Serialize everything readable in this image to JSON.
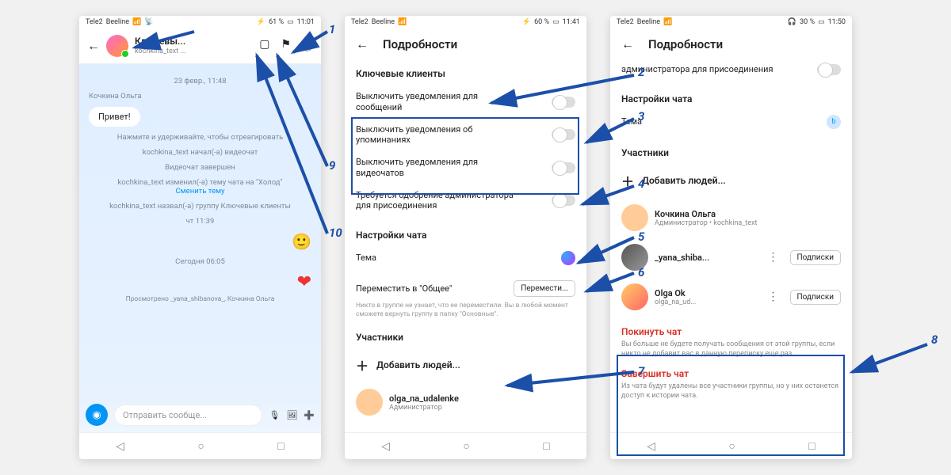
{
  "callouts": [
    "1",
    "2",
    "3",
    "4",
    "5",
    "6",
    "7",
    "8",
    "9",
    "10"
  ],
  "phone1": {
    "status": {
      "carrier1": "Tele2",
      "carrier2": "Beeline",
      "battery": "61 %",
      "time": "11:01"
    },
    "header": {
      "title": "Ключевы...",
      "subtitle": "kochkina_text ..."
    },
    "date1": "23 февр., 11:48",
    "sender": "Кочкина Ольга",
    "msg": "Привет!",
    "hint": "Нажмите и удерживайте, чтобы отреагировать",
    "sys1": "kochkina_text начал(-а) видеочат",
    "sys2": "Видеочат завершен",
    "sys3a": "kochkina_text изменил(-а) тему чата на \"Холод\"",
    "sys3b": "Сменить тему",
    "sys4": "kochkina_text назвал(-а) группу Ключевые клиенты",
    "time2": "чт 11:39",
    "time3": "Сегодня 06:05",
    "seen": "Просмотрено _yana_shibanova_, Кочкина Ольга",
    "composer": "Отправить сообще..."
  },
  "phone2": {
    "status": {
      "carrier1": "Tele2",
      "carrier2": "Beeline",
      "battery": "60 %",
      "time": "11:41"
    },
    "title": "Подробности",
    "group": "Ключевые клиенты",
    "toggles": {
      "t1": "Выключить уведомления для сообщений",
      "t2": "Выключить уведомления об упоминаниях",
      "t3": "Выключить уведомления для видеочатов",
      "t4": "Требуется одобрение администратора для присоединения"
    },
    "sect_settings": "Настройки чата",
    "theme_label": "Тема",
    "move_label": "Переместить в \"Общее\"",
    "move_btn": "Перемести...",
    "move_note": "Никто в группе не узнает, что ее переместили. Вы в любой момент сможете вернуть группу в папку \"Основные\".",
    "sect_members": "Участники",
    "add": "Добавить людей...",
    "member1_name": "olga_na_udalenke",
    "member1_role": "Администратор"
  },
  "phone3": {
    "status": {
      "carrier1": "Tele2",
      "carrier2": "Beeline",
      "battery": "30 %",
      "time": "11:50"
    },
    "title": "Подробности",
    "top_cut": "администратора для присоединения",
    "sect_settings": "Настройки чата",
    "theme_label": "Тема",
    "sect_members": "Участники",
    "add": "Добавить людей...",
    "m1_name": "Кочкина Ольга",
    "m1_role": "Администратор • kochkina_text",
    "m2_name": "_yana_shiba...",
    "m3_name": "Olga Ok",
    "m3_sub": "olga_na_ud...",
    "sub_btn": "Подписки",
    "leave": "Покинуть чат",
    "leave_note": "Вы больше не будете получать сообщения от этой группы, если никто не добавит вас в данную переписку еще раз.",
    "end": "Завершить чат",
    "end_note": "Из чата будут удалены все участники группы, но у них останется доступ к истории чата."
  }
}
